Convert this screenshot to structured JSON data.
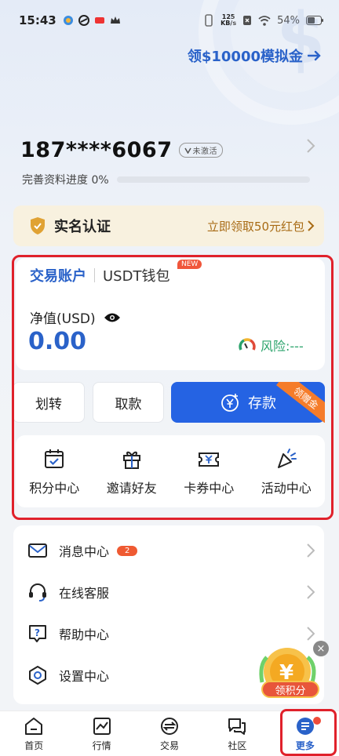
{
  "status_bar": {
    "time": "15:43",
    "net_speed_value": "125",
    "net_speed_unit": "KB/s",
    "battery": "54%"
  },
  "header": {
    "promo_link": "领$10000模拟金"
  },
  "profile": {
    "phone": "187****6067",
    "status_badge": "未激活",
    "progress_label": "完善资料进度 0%",
    "progress": 0
  },
  "verification": {
    "label": "实名认证",
    "cta": "立即领取50元红包"
  },
  "account": {
    "tabs": [
      {
        "label": "交易账户"
      },
      {
        "label": "USDT钱包"
      }
    ],
    "new_badge": "NEW",
    "net_value_label": "净值(USD)",
    "net_value": "0.00",
    "risk_label": "风险:---"
  },
  "actions": {
    "transfer": "划转",
    "withdraw": "取款",
    "deposit": "存款",
    "deposit_ribbon": "领赠金"
  },
  "quick_grid": [
    {
      "label": "积分中心",
      "icon": "calendar-check-icon"
    },
    {
      "label": "邀请好友",
      "icon": "gift-icon"
    },
    {
      "label": "卡券中心",
      "icon": "coupon-icon"
    },
    {
      "label": "活动中心",
      "icon": "party-popper-icon"
    }
  ],
  "menu": [
    {
      "label": "消息中心",
      "icon": "mail-icon",
      "badge": "2"
    },
    {
      "label": "在线客服",
      "icon": "headset-icon"
    },
    {
      "label": "帮助中心",
      "icon": "help-icon"
    },
    {
      "label": "设置中心",
      "icon": "settings-icon"
    }
  ],
  "floating": {
    "label": "领积分"
  },
  "bottom_nav": [
    {
      "label": "首页",
      "icon": "home-icon"
    },
    {
      "label": "行情",
      "icon": "chart-icon"
    },
    {
      "label": "交易",
      "icon": "trade-icon"
    },
    {
      "label": "社区",
      "icon": "chat-icon"
    },
    {
      "label": "更多",
      "icon": "more-icon",
      "active": true
    }
  ],
  "colors": {
    "accent": "#2a62c9",
    "deposit_button": "#2563e3",
    "highlight_frame": "#e0212b",
    "badge": "#ef5a32",
    "verify_bg": "#f8f1df",
    "risk_green": "#2aa36b"
  }
}
